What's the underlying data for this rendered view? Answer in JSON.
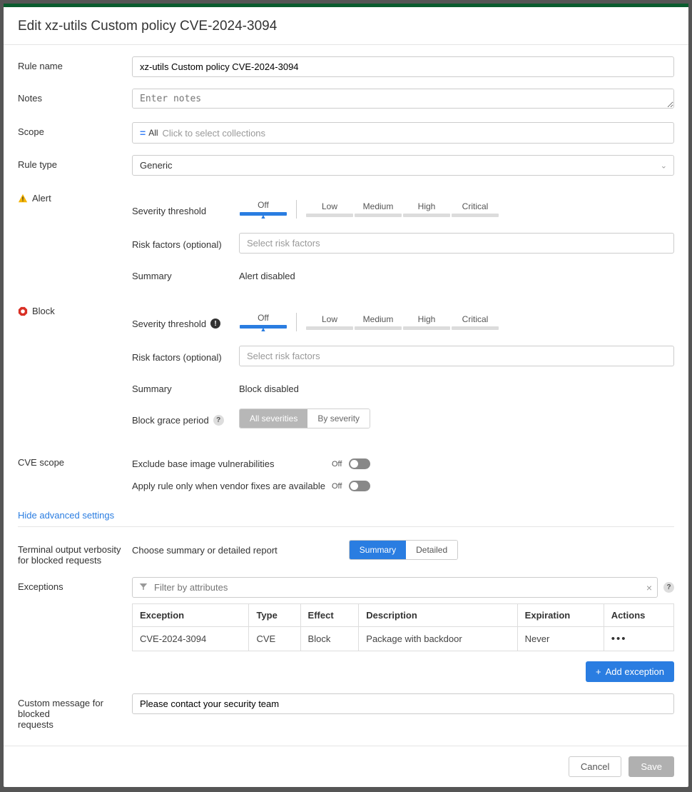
{
  "header": {
    "title": "Edit xz-utils Custom policy CVE-2024-3094"
  },
  "form": {
    "rule_name_label": "Rule name",
    "rule_name_value": "xz-utils Custom policy CVE-2024-3094",
    "notes_label": "Notes",
    "notes_placeholder": "Enter notes",
    "scope_label": "Scope",
    "scope_all": "All",
    "scope_placeholder": "Click to select collections",
    "rule_type_label": "Rule type",
    "rule_type_value": "Generic"
  },
  "alert": {
    "heading": "Alert",
    "severity_label": "Severity threshold",
    "risk_label": "Risk factors (optional)",
    "risk_placeholder": "Select risk factors",
    "summary_label": "Summary",
    "summary_text": "Alert disabled"
  },
  "block": {
    "heading": "Block",
    "severity_label": "Severity threshold",
    "risk_label": "Risk factors (optional)",
    "risk_placeholder": "Select risk factors",
    "summary_label": "Summary",
    "summary_text": "Block disabled",
    "grace_label": "Block grace period",
    "grace_opts": [
      "All severities",
      "By severity"
    ]
  },
  "severity_levels": [
    "Off",
    "Low",
    "Medium",
    "High",
    "Critical"
  ],
  "cve_scope": {
    "label": "CVE scope",
    "exclude_base": "Exclude base image vulnerabilities",
    "vendor_fixes": "Apply rule only when vendor fixes are available",
    "off": "Off"
  },
  "advanced": {
    "link": "Hide advanced settings",
    "terminal_label1": "Terminal output verbosity",
    "terminal_label2": "for blocked requests",
    "terminal_sub": "Choose summary or detailed report",
    "terminal_opts": [
      "Summary",
      "Detailed"
    ],
    "exceptions_label": "Exceptions",
    "filter_placeholder": "Filter by attributes",
    "table_headers": [
      "Exception",
      "Type",
      "Effect",
      "Description",
      "Expiration",
      "Actions"
    ],
    "table_rows": [
      {
        "exception": "CVE-2024-3094",
        "type": "CVE",
        "effect": "Block",
        "description": "Package with backdoor",
        "expiration": "Never"
      }
    ],
    "add_exception": "Add exception",
    "custom_msg_label1": "Custom message for blocked",
    "custom_msg_label2": "requests",
    "custom_msg_value": "Please contact your security team"
  },
  "footer": {
    "cancel": "Cancel",
    "save": "Save"
  }
}
